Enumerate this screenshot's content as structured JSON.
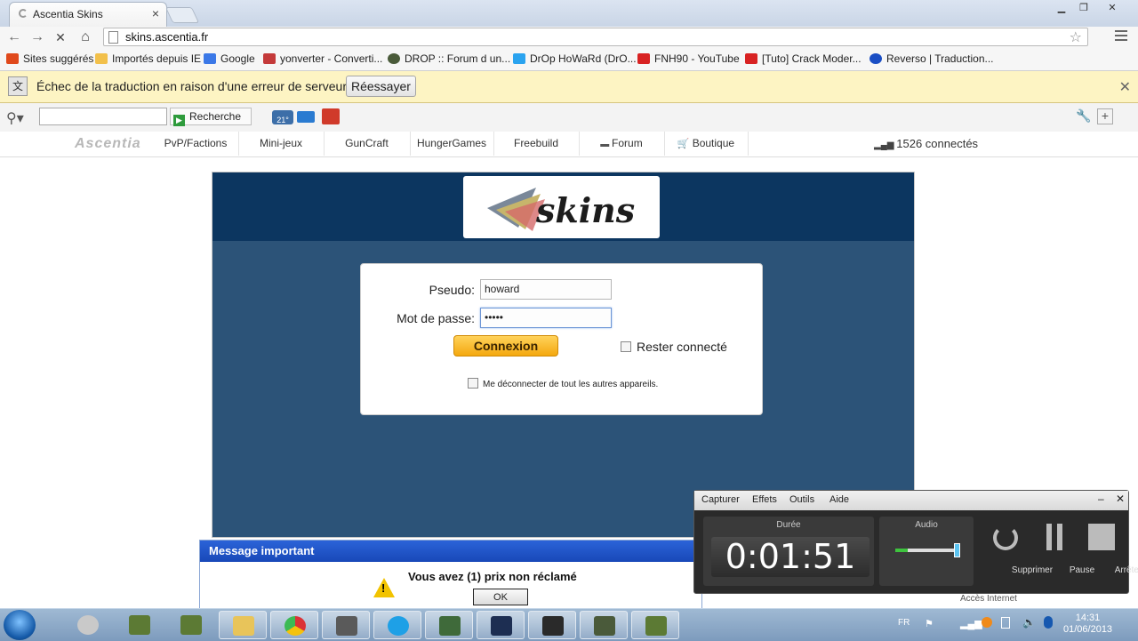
{
  "browser": {
    "tab_title": "Ascentia Skins",
    "url": "skins.ascentia.fr",
    "bookmarks": [
      {
        "label": "Sites suggérés",
        "icon": "suggested-sites-icon",
        "color": "#e0491c"
      },
      {
        "label": "Importés depuis IE",
        "icon": "folder-icon",
        "color": "#f2c04b"
      },
      {
        "label": "Google",
        "icon": "google-icon",
        "color": "#3b78e7"
      },
      {
        "label": "yonverter - Converti...",
        "icon": "magnet-icon",
        "color": "#c43a3a"
      },
      {
        "label": "DROP :: Forum d un...",
        "icon": "forum-icon",
        "color": "#4a5b3a"
      },
      {
        "label": "DrOp HoWaRd (DrO...",
        "icon": "twitter-icon",
        "color": "#2aa3ef"
      },
      {
        "label": "FNH90 - YouTube",
        "icon": "youtube-icon",
        "color": "#d82222"
      },
      {
        "label": "[Tuto] Crack Moder...",
        "icon": "youtube-icon",
        "color": "#d82222"
      },
      {
        "label": "Reverso | Traduction...",
        "icon": "reverso-icon",
        "color": "#1a4ec4"
      }
    ]
  },
  "infobar": {
    "message": "Échec de la traduction en raison d'une erreur de serveur",
    "retry_label": "Réessayer"
  },
  "addonbar": {
    "search_button": "Recherche",
    "weather_temp": "21°"
  },
  "sitenav": {
    "logo": "Ascentia",
    "items": [
      "PvP/Factions",
      "Mini-jeux",
      "GunCraft",
      "HungerGames",
      "Freebuild",
      "Forum",
      "Boutique"
    ],
    "online": "1526 connectés"
  },
  "page": {
    "logo_text": "skins",
    "login": {
      "username_label": "Pseudo:",
      "username_value": "howard",
      "password_label": "Mot de passe:",
      "password_value": "•••••",
      "submit_label": "Connexion",
      "remember_label": "Rester connecté",
      "logout_others_label": "Me déconnecter de tout les autres appareils."
    }
  },
  "dialog": {
    "title": "Message important",
    "message": "Vous avez (1) prix non réclamé",
    "ok_label": "OK"
  },
  "recorder": {
    "menu": [
      "Capturer",
      "Effets",
      "Outils",
      "Aide"
    ],
    "duration_label": "Durée",
    "duration": "0:01:51",
    "audio_label": "Audio",
    "delete_label": "Supprimer",
    "pause_label": "Pause",
    "stop_label": "Arrêter",
    "behind_text": "Accès Internet"
  },
  "taskbar": {
    "language": "FR",
    "time": "14:31",
    "date": "01/06/2013"
  },
  "colors": {
    "panel_dark": "#0c3660",
    "panel": "#2c5378",
    "button_orange": "#f4a80f",
    "dialog_title": "#1848b8"
  }
}
